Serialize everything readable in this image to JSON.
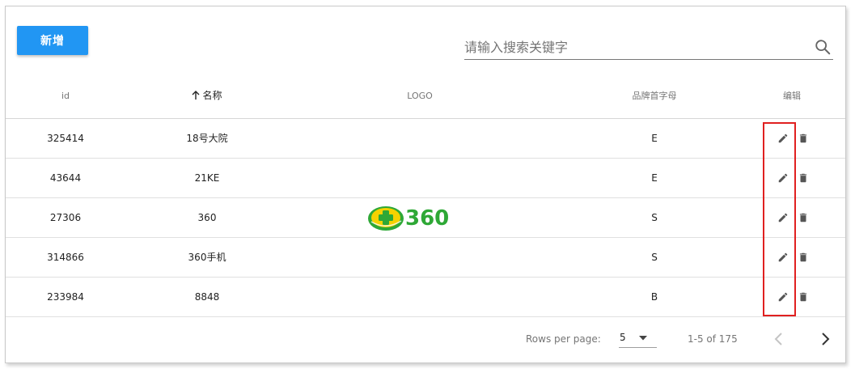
{
  "toolbar": {
    "add_label": "新增",
    "search_placeholder": "请输入搜索关键字",
    "search_value": ""
  },
  "table": {
    "headers": {
      "id": "id",
      "name": "名称",
      "logo": "LOGO",
      "letter": "品牌首字母",
      "edit": "编辑"
    },
    "sorted_column": "name",
    "sort_direction": "ascending",
    "rows": [
      {
        "id": "325414",
        "name": "18号大院",
        "letter": "E",
        "has_logo": false
      },
      {
        "id": "43644",
        "name": "21KE",
        "letter": "E",
        "has_logo": false
      },
      {
        "id": "27306",
        "name": "360",
        "letter": "S",
        "has_logo": true
      },
      {
        "id": "314866",
        "name": "360手机",
        "letter": "S",
        "has_logo": false
      },
      {
        "id": "233984",
        "name": "8848",
        "letter": "B",
        "has_logo": false
      }
    ],
    "logo_text": "360"
  },
  "pagination": {
    "rows_per_page_label": "Rows per page:",
    "rows_per_page": "5",
    "range": "1-5 of 175"
  },
  "colors": {
    "primary": "#2196f3",
    "highlight": "#e02020",
    "logo_green": "#2ea836",
    "logo_yellow": "#f5d200"
  },
  "icons": [
    "search-icon",
    "sort-arrow-up-icon",
    "edit-icon",
    "delete-icon",
    "chevron-down-icon",
    "chevron-left-icon",
    "chevron-right-icon"
  ]
}
